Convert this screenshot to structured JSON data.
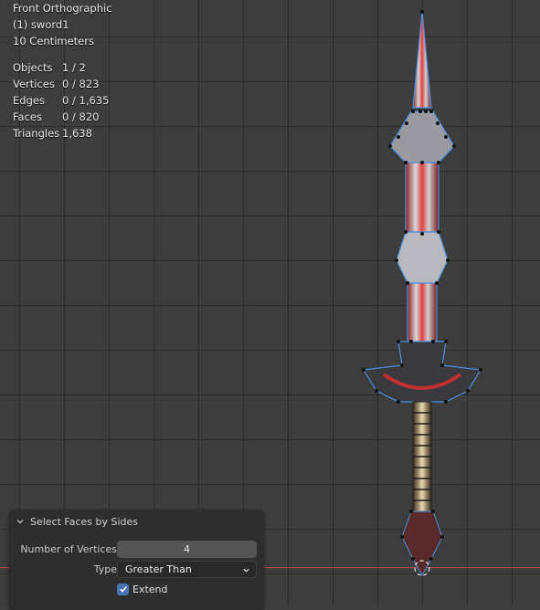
{
  "viewport": {
    "view_name": "Front Orthographic",
    "object_name": "(1) sword1",
    "scale": "10 Centimeters",
    "stats": [
      {
        "label": "Objects",
        "value": "1 / 2"
      },
      {
        "label": "Vertices",
        "value": "0 / 823"
      },
      {
        "label": "Edges",
        "value": "0 / 1,635"
      },
      {
        "label": "Faces",
        "value": "0 / 820"
      },
      {
        "label": "Triangles",
        "value": "1,638"
      }
    ]
  },
  "panel": {
    "title": "Select Faces by Sides",
    "number_of_vertices_label": "Number of Vertices",
    "number_of_vertices_value": "4",
    "type_label": "Type",
    "type_value": "Greater Than",
    "extend_label": "Extend",
    "extend_checked": true
  },
  "colors": {
    "background": "#3d3d3d",
    "panel": "#2e2e2e",
    "accent": "#4772b3",
    "x_axis": "#b34b4b",
    "sword_outline": "#4a8fe0"
  }
}
